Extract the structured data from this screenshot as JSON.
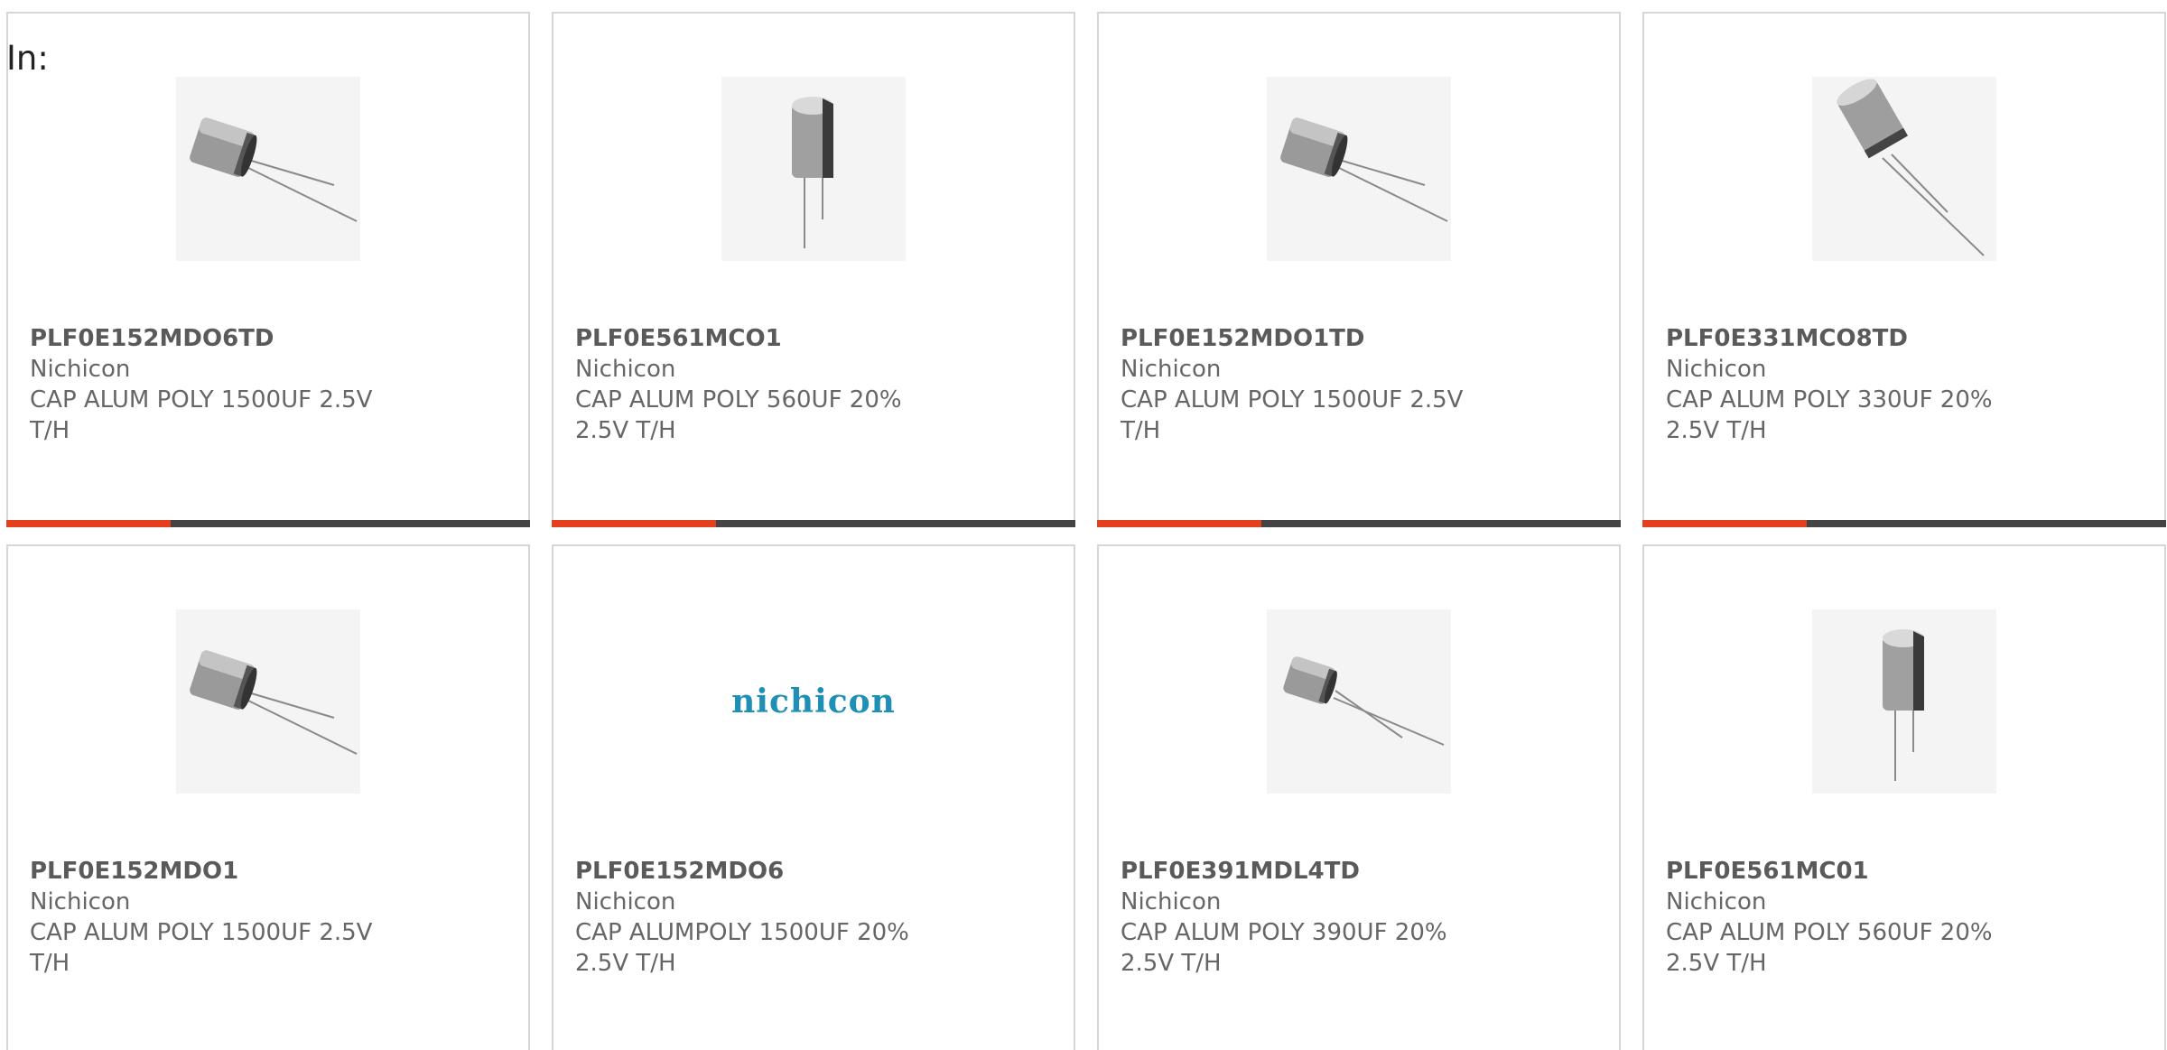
{
  "filter": {
    "label": "In:"
  },
  "colors": {
    "accent": "#e4401e",
    "bar": "#444444",
    "border": "#d6d6d6",
    "brand": "#1f8fb5"
  },
  "products": [
    {
      "part": "PLF0E152MDO6TD",
      "manufacturer": "Nichicon",
      "description": "CAP ALUM POLY 1500UF 2.5V T/H",
      "image": "capacitor-angled-icon"
    },
    {
      "part": "PLF0E561MCO1",
      "manufacturer": "Nichicon",
      "description": "CAP ALUM POLY 560UF 20% 2.5V T/H",
      "image": "capacitor-upright-icon"
    },
    {
      "part": "PLF0E152MDO1TD",
      "manufacturer": "Nichicon",
      "description": "CAP ALUM POLY 1500UF 2.5V T/H",
      "image": "capacitor-angled-icon"
    },
    {
      "part": "PLF0E331MCO8TD",
      "manufacturer": "Nichicon",
      "description": "CAP ALUM POLY 330UF 20% 2.5V T/H",
      "image": "capacitor-tilted-icon"
    },
    {
      "part": "PLF0E152MDO1",
      "manufacturer": "Nichicon",
      "description": "CAP ALUM POLY 1500UF 2.5V T/H",
      "image": "capacitor-angled-icon"
    },
    {
      "part": "PLF0E152MDO6",
      "manufacturer": "Nichicon",
      "description": "CAP ALUMPOLY 1500UF 20% 2.5V T/H",
      "image": "nichicon-logo",
      "logo_text": "nichicon"
    },
    {
      "part": "PLF0E391MDL4TD",
      "manufacturer": "Nichicon",
      "description": "CAP ALUM POLY 390UF 20% 2.5V T/H",
      "image": "capacitor-angled-small-icon"
    },
    {
      "part": "PLF0E561MC01",
      "manufacturer": "Nichicon",
      "description": "CAP ALUM POLY 560UF 20% 2.5V T/H",
      "image": "capacitor-upright-icon"
    }
  ]
}
